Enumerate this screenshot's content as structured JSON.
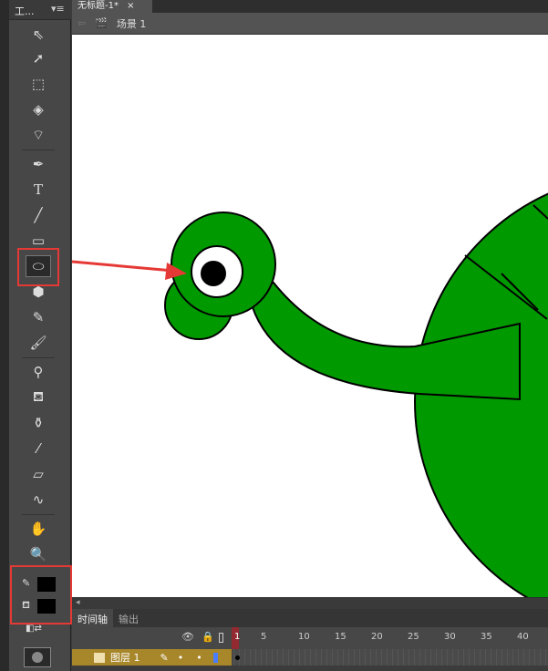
{
  "document_tab": {
    "title": "无标题-1*",
    "close": "×"
  },
  "tools_panel": {
    "title": "工...",
    "menu_icon": "panel-menu-icon",
    "tools": [
      "selection",
      "subselection",
      "free-transform",
      "3d-rotation",
      "lasso",
      "pen",
      "text",
      "line",
      "rectangle",
      "oval",
      "polystar",
      "pencil",
      "brush",
      "bone",
      "paint-bucket",
      "ink-bottle",
      "eyedropper",
      "eraser",
      "width",
      "hand",
      "zoom"
    ],
    "selected_tool": "oval",
    "stroke_color": "#000000",
    "fill_color": "#000000"
  },
  "scene": {
    "label": "场景 1"
  },
  "timeline": {
    "tabs": [
      "时间轴",
      "输出"
    ],
    "active_tab": "时间轴",
    "frame_labels": [
      "1",
      "5",
      "10",
      "15",
      "20",
      "25",
      "30",
      "35",
      "40"
    ],
    "current_frame": "1",
    "layers": [
      {
        "name": "图层 1"
      }
    ]
  },
  "colors": {
    "turtle_green": "#009900",
    "highlight": "#e53935",
    "layer_selected": "#a8862a"
  }
}
